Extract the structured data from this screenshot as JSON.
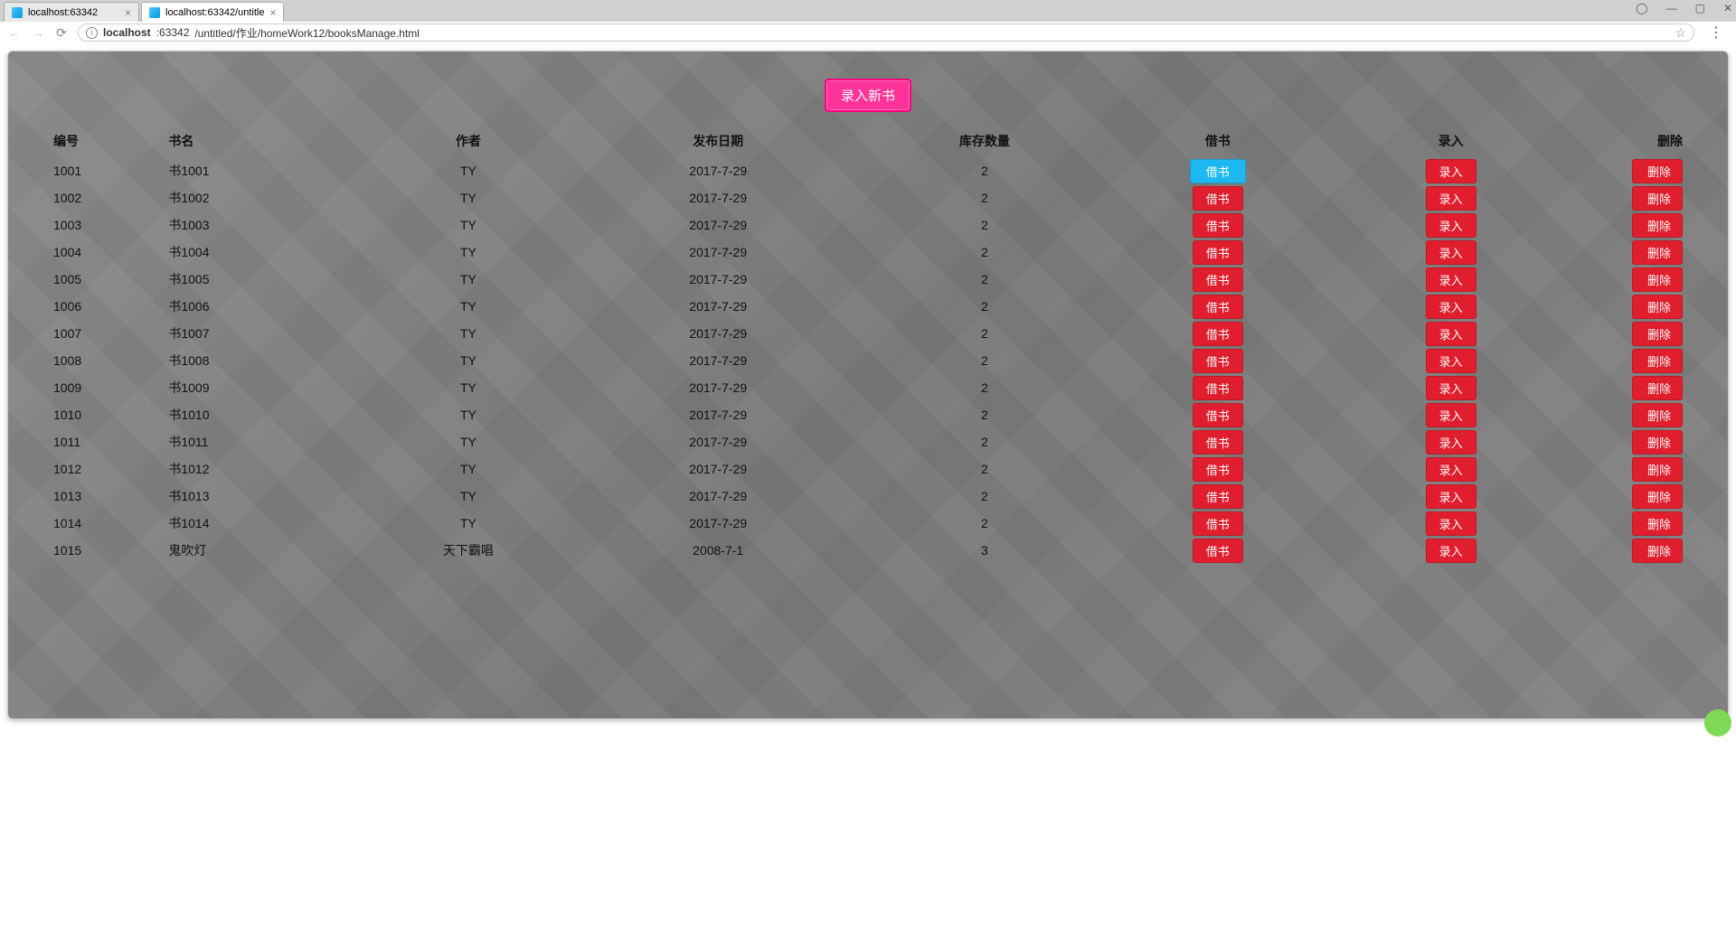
{
  "browser": {
    "tabs": [
      {
        "title": "localhost:63342"
      },
      {
        "title": "localhost:63342/untitle"
      }
    ],
    "url_host": "localhost",
    "url_port": ":63342",
    "url_path": "/untitled/作业/homeWork12/booksManage.html"
  },
  "add_button_label": "录入新书",
  "headers": {
    "id": "编号",
    "name": "书名",
    "author": "作者",
    "date": "发布日期",
    "stock": "库存数量",
    "borrow": "借书",
    "enter": "录入",
    "delete": "删除"
  },
  "row_buttons": {
    "borrow": "借书",
    "enter": "录入",
    "delete": "删除"
  },
  "rows": [
    {
      "id": "1001",
      "name": "书1001",
      "author": "TY",
      "date": "2017-7-29",
      "stock": "2",
      "highlight": true
    },
    {
      "id": "1002",
      "name": "书1002",
      "author": "TY",
      "date": "2017-7-29",
      "stock": "2"
    },
    {
      "id": "1003",
      "name": "书1003",
      "author": "TY",
      "date": "2017-7-29",
      "stock": "2"
    },
    {
      "id": "1004",
      "name": "书1004",
      "author": "TY",
      "date": "2017-7-29",
      "stock": "2"
    },
    {
      "id": "1005",
      "name": "书1005",
      "author": "TY",
      "date": "2017-7-29",
      "stock": "2"
    },
    {
      "id": "1006",
      "name": "书1006",
      "author": "TY",
      "date": "2017-7-29",
      "stock": "2"
    },
    {
      "id": "1007",
      "name": "书1007",
      "author": "TY",
      "date": "2017-7-29",
      "stock": "2"
    },
    {
      "id": "1008",
      "name": "书1008",
      "author": "TY",
      "date": "2017-7-29",
      "stock": "2"
    },
    {
      "id": "1009",
      "name": "书1009",
      "author": "TY",
      "date": "2017-7-29",
      "stock": "2"
    },
    {
      "id": "1010",
      "name": "书1010",
      "author": "TY",
      "date": "2017-7-29",
      "stock": "2"
    },
    {
      "id": "1011",
      "name": "书1011",
      "author": "TY",
      "date": "2017-7-29",
      "stock": "2"
    },
    {
      "id": "1012",
      "name": "书1012",
      "author": "TY",
      "date": "2017-7-29",
      "stock": "2"
    },
    {
      "id": "1013",
      "name": "书1013",
      "author": "TY",
      "date": "2017-7-29",
      "stock": "2"
    },
    {
      "id": "1014",
      "name": "书1014",
      "author": "TY",
      "date": "2017-7-29",
      "stock": "2"
    },
    {
      "id": "1015",
      "name": "鬼吹灯",
      "author": "天下霸唱",
      "date": "2008-7-1",
      "stock": "3"
    }
  ]
}
